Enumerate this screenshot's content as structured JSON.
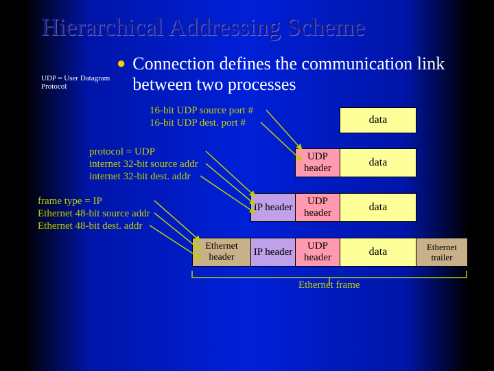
{
  "title": "Hierarchical Addressing Scheme",
  "side_note": "UDP = User Datagram Protocol",
  "bullet": "Connection defines the communication link between two processes",
  "rows": {
    "r1": {
      "data": "data"
    },
    "r2": {
      "udp": "UDP header",
      "data": "data"
    },
    "r3": {
      "ip": "IP header",
      "udp": "UDP header",
      "data": "data"
    },
    "r4": {
      "ethh": "Ethernet header",
      "ip": "IP header",
      "udp": "UDP header",
      "data": "data",
      "etht": "Ethernet trailer"
    }
  },
  "ann": {
    "a1a": "16-bit UDP source port #",
    "a1b": "16-bit UDP dest. port #",
    "a2a": "protocol = UDP",
    "a2b": "internet 32-bit source addr",
    "a2c": "internet 32-bit dest. addr",
    "a3a": "frame type = IP",
    "a3b": "Ethernet 48-bit source addr",
    "a3c": "Ethernet 48-bit dest. addr",
    "frame": "Ethernet frame"
  }
}
